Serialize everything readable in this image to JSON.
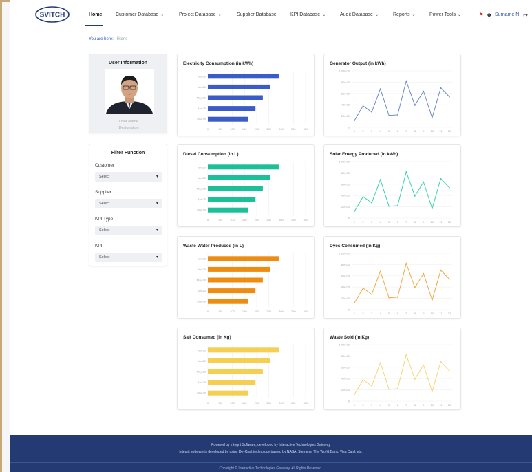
{
  "nav": {
    "logo_text": "SVITCH",
    "items": [
      {
        "label": "Home",
        "chevron": false,
        "active": true
      },
      {
        "label": "Customer Database",
        "chevron": true
      },
      {
        "label": "Project Database",
        "chevron": true
      },
      {
        "label": "Supplier Database",
        "chevron": false
      },
      {
        "label": "KPI Database",
        "chevron": true
      },
      {
        "label": "Audit Database",
        "chevron": true
      },
      {
        "label": "Reports",
        "chevron": true
      },
      {
        "label": "Power Tools",
        "chevron": true
      }
    ],
    "user_name": "Surname N.",
    "accent": "#243a73"
  },
  "breadcrumb": {
    "prefix": "You are here:",
    "current": "Home"
  },
  "user_info": {
    "title": "User Information",
    "name": "User Name",
    "designation": "Designation"
  },
  "filter": {
    "title": "Filter Function",
    "fields": [
      {
        "label": "Customer",
        "value": "Select"
      },
      {
        "label": "Supplier",
        "value": "Select"
      },
      {
        "label": "KPI Type",
        "value": "Select"
      },
      {
        "label": "KPI",
        "value": "Select"
      }
    ]
  },
  "bar_axis_ticks": [
    "0",
    "50",
    "100",
    "150",
    "200",
    "250",
    "300",
    "350",
    "400"
  ],
  "line_axis": {
    "yticks": [
      "0",
      "200.00",
      "400.00",
      "600.00",
      "800.00",
      "1,000.00"
    ],
    "xticks": [
      "1",
      "2",
      "3",
      "4",
      "5",
      "6",
      "7",
      "8",
      "9",
      "10",
      "11",
      "12"
    ]
  },
  "chart_data": [
    {
      "type": "bar",
      "title": "Electricity Consumption (in kWh)",
      "color": "#3a5cc8",
      "categories": [
        "Jun-20",
        "Jan-20",
        "May-20",
        "Apr-20",
        "Mar-20"
      ],
      "values": [
        290,
        255,
        225,
        195,
        165
      ],
      "xlim": [
        0,
        400
      ]
    },
    {
      "type": "line",
      "title": "Generator Output (in kWh)",
      "color": "#6c86cc",
      "x": [
        1,
        2,
        3,
        4,
        5,
        6,
        7,
        8,
        9,
        10,
        11,
        12
      ],
      "values": [
        120,
        380,
        270,
        680,
        210,
        220,
        820,
        390,
        640,
        170,
        700,
        540
      ],
      "ylim": [
        0,
        1000
      ]
    },
    {
      "type": "bar",
      "title": "Diesel Consumption (in L)",
      "color": "#1bbf98",
      "categories": [
        "Jun-20",
        "Jan-20",
        "May-20",
        "Apr-20",
        "Mar-20"
      ],
      "values": [
        290,
        255,
        225,
        195,
        165
      ],
      "xlim": [
        0,
        400
      ]
    },
    {
      "type": "line",
      "title": "Solar Energy Produced (in kWh)",
      "color": "#34d3a8",
      "x": [
        1,
        2,
        3,
        4,
        5,
        6,
        7,
        8,
        9,
        10,
        11,
        12
      ],
      "values": [
        120,
        380,
        270,
        680,
        210,
        220,
        820,
        390,
        640,
        170,
        700,
        540
      ],
      "ylim": [
        0,
        1000
      ]
    },
    {
      "type": "bar",
      "title": "Waste Water Produced (in L)",
      "color": "#ee8c12",
      "categories": [
        "Jun-20",
        "Jan-20",
        "May-20",
        "Apr-20",
        "Mar-20"
      ],
      "values": [
        290,
        255,
        225,
        195,
        165
      ],
      "xlim": [
        0,
        400
      ]
    },
    {
      "type": "line",
      "title": "Dyes Consumed (in Kg)",
      "color": "#f0a840",
      "x": [
        1,
        2,
        3,
        4,
        5,
        6,
        7,
        8,
        9,
        10,
        11,
        12
      ],
      "values": [
        120,
        380,
        270,
        680,
        210,
        220,
        820,
        390,
        640,
        170,
        700,
        540
      ],
      "ylim": [
        0,
        1000
      ]
    },
    {
      "type": "bar",
      "title": "Salt Consumed (in Kg)",
      "color": "#f5cf52",
      "categories": [
        "Jun-20",
        "Jan-20",
        "May-20",
        "Apr-20",
        "Mar-20"
      ],
      "values": [
        290,
        255,
        225,
        195,
        165
      ],
      "xlim": [
        0,
        400
      ]
    },
    {
      "type": "line",
      "title": "Waste Sold (in Kg)",
      "color": "#f6d470",
      "x": [
        1,
        2,
        3,
        4,
        5,
        6,
        7,
        8,
        9,
        10,
        11,
        12
      ],
      "values": [
        120,
        380,
        270,
        680,
        210,
        220,
        820,
        390,
        640,
        170,
        700,
        540
      ],
      "ylim": [
        0,
        1000
      ]
    }
  ],
  "footer": {
    "line1": "Powered by Integrit Software, developed by Interactive Technologies Gateway",
    "line2": "Integrit software is developed by using DevCraft technology trusted by NASA, Siemens, The World Bank, Visa Card, etc.",
    "copyright": "Copyright © Interactive Technologies Gateway. All Rights Reserved."
  }
}
